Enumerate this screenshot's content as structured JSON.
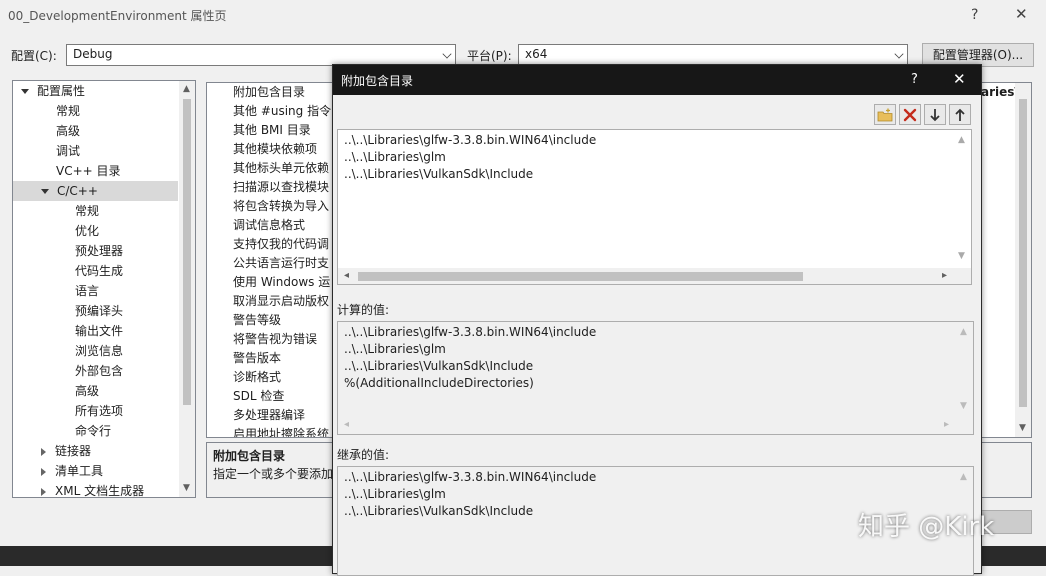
{
  "window": {
    "title": "00_DevelopmentEnvironment 属性页",
    "help_label": "?",
    "close_label": "✕"
  },
  "config_bar": {
    "config_label": "配置(C):",
    "config_value": "Debug",
    "platform_label": "平台(P):",
    "platform_value": "x64",
    "manager_button": "配置管理器(O)..."
  },
  "tree": {
    "items": [
      {
        "label": "配置属性",
        "state": "expanded"
      },
      {
        "label": "常规"
      },
      {
        "label": "高级"
      },
      {
        "label": "调试"
      },
      {
        "label": "VC++ 目录"
      },
      {
        "label": "C/C++",
        "state": "expanded",
        "selected": true
      },
      {
        "label": "常规"
      },
      {
        "label": "优化"
      },
      {
        "label": "预处理器"
      },
      {
        "label": "代码生成"
      },
      {
        "label": "语言"
      },
      {
        "label": "预编译头"
      },
      {
        "label": "输出文件"
      },
      {
        "label": "浏览信息"
      },
      {
        "label": "外部包含"
      },
      {
        "label": "高级"
      },
      {
        "label": "所有选项"
      },
      {
        "label": "命令行"
      },
      {
        "label": "链接器",
        "state": "collapsed"
      },
      {
        "label": "清单工具",
        "state": "collapsed"
      },
      {
        "label": "XML 文档生成器",
        "state": "collapsed"
      }
    ]
  },
  "grid": {
    "rows": [
      "附加包含目录",
      "其他 #using 指令",
      "其他 BMI 目录",
      "其他模块依赖项",
      "其他标头单元依赖",
      "扫描源以查找模块",
      "将包含转换为导入",
      "调试信息格式",
      "支持仅我的代码调",
      "公共语言运行时支",
      "使用 Windows 运",
      "取消显示启动版权",
      "警告等级",
      "将警告视为错误",
      "警告版本",
      "诊断格式",
      "SDL 检查",
      "多处理器编译",
      "启用地址擦除系统"
    ],
    "value_header_fragment": "aries\\"
  },
  "description": {
    "title": "附加包含目录",
    "text": "指定一个或多个要添加"
  },
  "dialog": {
    "title": "附加包含目录",
    "help_label": "?",
    "close_label": "✕",
    "editable_lines": [
      "..\\..\\Libraries\\glfw-3.3.8.bin.WIN64\\include",
      "..\\..\\Libraries\\glm",
      "..\\..\\Libraries\\VulkanSdk\\Include"
    ],
    "computed_label": "计算的值:",
    "computed_lines": [
      "..\\..\\Libraries\\glfw-3.3.8.bin.WIN64\\include",
      "..\\..\\Libraries\\glm",
      "..\\..\\Libraries\\VulkanSdk\\Include",
      "%(AdditionalIncludeDirectories)"
    ],
    "inherited_label": "继承的值:",
    "inherited_lines": [
      "..\\..\\Libraries\\glfw-3.3.8.bin.WIN64\\include",
      "..\\..\\Libraries\\glm",
      "..\\..\\Libraries\\VulkanSdk\\Include"
    ]
  },
  "watermark": "知乎 @Kirk",
  "colors": {
    "dialog_titlebar": "#171717",
    "selection": "#d9d9d9",
    "delete_icon": "#c42b1c",
    "new_folder_icon": "#d9a53b"
  },
  "icons": [
    "new-folder-icon",
    "delete-icon",
    "move-down-icon",
    "move-up-icon",
    "chevron-down-icon",
    "scroll-left-icon",
    "scroll-right-icon"
  ]
}
